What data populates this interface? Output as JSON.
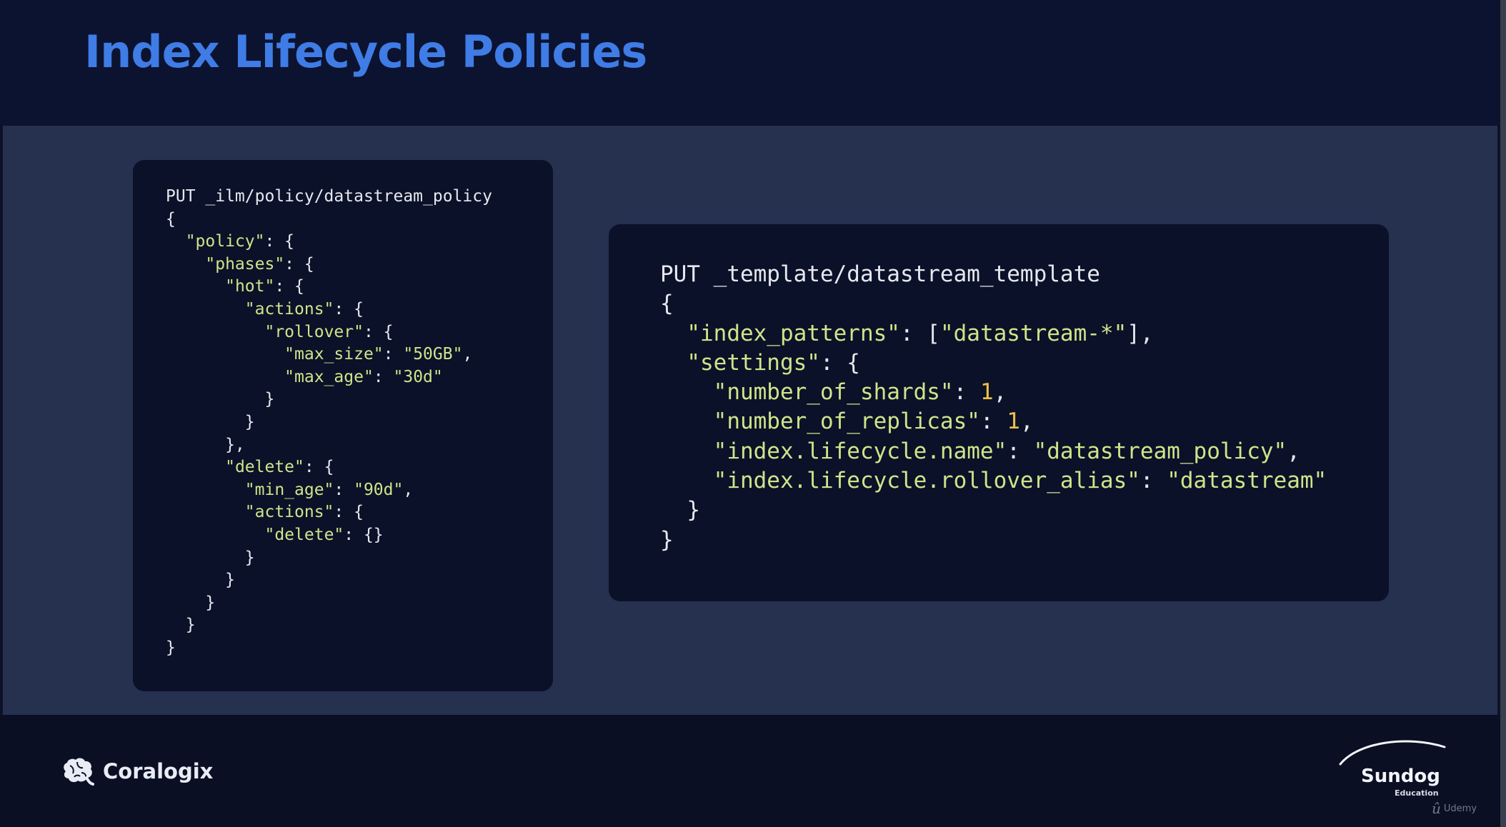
{
  "slide": {
    "title": "Index Lifecycle Policies"
  },
  "code_left": {
    "lines": [
      [
        {
          "t": "PUT _ilm/policy/datastream_policy",
          "c": "plain"
        }
      ],
      [
        {
          "t": "{",
          "c": "plain"
        }
      ],
      [
        {
          "t": "  ",
          "c": "plain"
        },
        {
          "t": "\"policy\"",
          "c": "str"
        },
        {
          "t": ": {",
          "c": "plain"
        }
      ],
      [
        {
          "t": "    ",
          "c": "plain"
        },
        {
          "t": "\"phases\"",
          "c": "str"
        },
        {
          "t": ": {",
          "c": "plain"
        }
      ],
      [
        {
          "t": "      ",
          "c": "plain"
        },
        {
          "t": "\"hot\"",
          "c": "str"
        },
        {
          "t": ": {",
          "c": "plain"
        }
      ],
      [
        {
          "t": "        ",
          "c": "plain"
        },
        {
          "t": "\"actions\"",
          "c": "str"
        },
        {
          "t": ": {",
          "c": "plain"
        }
      ],
      [
        {
          "t": "          ",
          "c": "plain"
        },
        {
          "t": "\"rollover\"",
          "c": "str"
        },
        {
          "t": ": {",
          "c": "plain"
        }
      ],
      [
        {
          "t": "            ",
          "c": "plain"
        },
        {
          "t": "\"max_size\"",
          "c": "str"
        },
        {
          "t": ": ",
          "c": "plain"
        },
        {
          "t": "\"50GB\"",
          "c": "str"
        },
        {
          "t": ",",
          "c": "plain"
        }
      ],
      [
        {
          "t": "            ",
          "c": "plain"
        },
        {
          "t": "\"max_age\"",
          "c": "str"
        },
        {
          "t": ": ",
          "c": "plain"
        },
        {
          "t": "\"30d\"",
          "c": "str"
        }
      ],
      [
        {
          "t": "          }",
          "c": "plain"
        }
      ],
      [
        {
          "t": "        }",
          "c": "plain"
        }
      ],
      [
        {
          "t": "      },",
          "c": "plain"
        }
      ],
      [
        {
          "t": "      ",
          "c": "plain"
        },
        {
          "t": "\"delete\"",
          "c": "str"
        },
        {
          "t": ": {",
          "c": "plain"
        }
      ],
      [
        {
          "t": "        ",
          "c": "plain"
        },
        {
          "t": "\"min_age\"",
          "c": "str"
        },
        {
          "t": ": ",
          "c": "plain"
        },
        {
          "t": "\"90d\"",
          "c": "str"
        },
        {
          "t": ",",
          "c": "plain"
        }
      ],
      [
        {
          "t": "        ",
          "c": "plain"
        },
        {
          "t": "\"actions\"",
          "c": "str"
        },
        {
          "t": ": {",
          "c": "plain"
        }
      ],
      [
        {
          "t": "          ",
          "c": "plain"
        },
        {
          "t": "\"delete\"",
          "c": "str"
        },
        {
          "t": ": {}",
          "c": "plain"
        }
      ],
      [
        {
          "t": "        }",
          "c": "plain"
        }
      ],
      [
        {
          "t": "      }",
          "c": "plain"
        }
      ],
      [
        {
          "t": "    }",
          "c": "plain"
        }
      ],
      [
        {
          "t": "  }",
          "c": "plain"
        }
      ],
      [
        {
          "t": "}",
          "c": "plain"
        }
      ]
    ]
  },
  "code_right": {
    "lines": [
      [
        {
          "t": "PUT _template/datastream_template",
          "c": "plain"
        }
      ],
      [
        {
          "t": "{",
          "c": "plain"
        }
      ],
      [
        {
          "t": "  ",
          "c": "plain"
        },
        {
          "t": "\"index_patterns\"",
          "c": "str"
        },
        {
          "t": ": [",
          "c": "plain"
        },
        {
          "t": "\"datastream-*\"",
          "c": "str"
        },
        {
          "t": "],",
          "c": "plain"
        }
      ],
      [
        {
          "t": "  ",
          "c": "plain"
        },
        {
          "t": "\"settings\"",
          "c": "str"
        },
        {
          "t": ": {",
          "c": "plain"
        }
      ],
      [
        {
          "t": "    ",
          "c": "plain"
        },
        {
          "t": "\"number_of_shards\"",
          "c": "str"
        },
        {
          "t": ": ",
          "c": "plain"
        },
        {
          "t": "1",
          "c": "num"
        },
        {
          "t": ",",
          "c": "plain"
        }
      ],
      [
        {
          "t": "    ",
          "c": "plain"
        },
        {
          "t": "\"number_of_replicas\"",
          "c": "str"
        },
        {
          "t": ": ",
          "c": "plain"
        },
        {
          "t": "1",
          "c": "num"
        },
        {
          "t": ",",
          "c": "plain"
        }
      ],
      [
        {
          "t": "    ",
          "c": "plain"
        },
        {
          "t": "\"index.lifecycle.name\"",
          "c": "str"
        },
        {
          "t": ": ",
          "c": "plain"
        },
        {
          "t": "\"datastream_policy\"",
          "c": "str"
        },
        {
          "t": ",",
          "c": "plain"
        }
      ],
      [
        {
          "t": "    ",
          "c": "plain"
        },
        {
          "t": "\"index.lifecycle.rollover_alias\"",
          "c": "str"
        },
        {
          "t": ": ",
          "c": "plain"
        },
        {
          "t": "\"datastream\"",
          "c": "str"
        }
      ],
      [
        {
          "t": "  }",
          "c": "plain"
        }
      ],
      [
        {
          "t": "}",
          "c": "plain"
        }
      ]
    ]
  },
  "footer": {
    "left_brand": "Coralogix",
    "left_brand_icon": "brain-icon",
    "right_brand": "Sundog",
    "right_brand_sub": "Education",
    "watermark": "Udemy",
    "watermark_icon": "udemy-icon"
  },
  "colors": {
    "title": "#3f7ce6",
    "string": "#cfe48a",
    "number": "#f0c04a",
    "plain": "#e6e8ef",
    "panel": "#0b1128",
    "band": "#26304f"
  }
}
